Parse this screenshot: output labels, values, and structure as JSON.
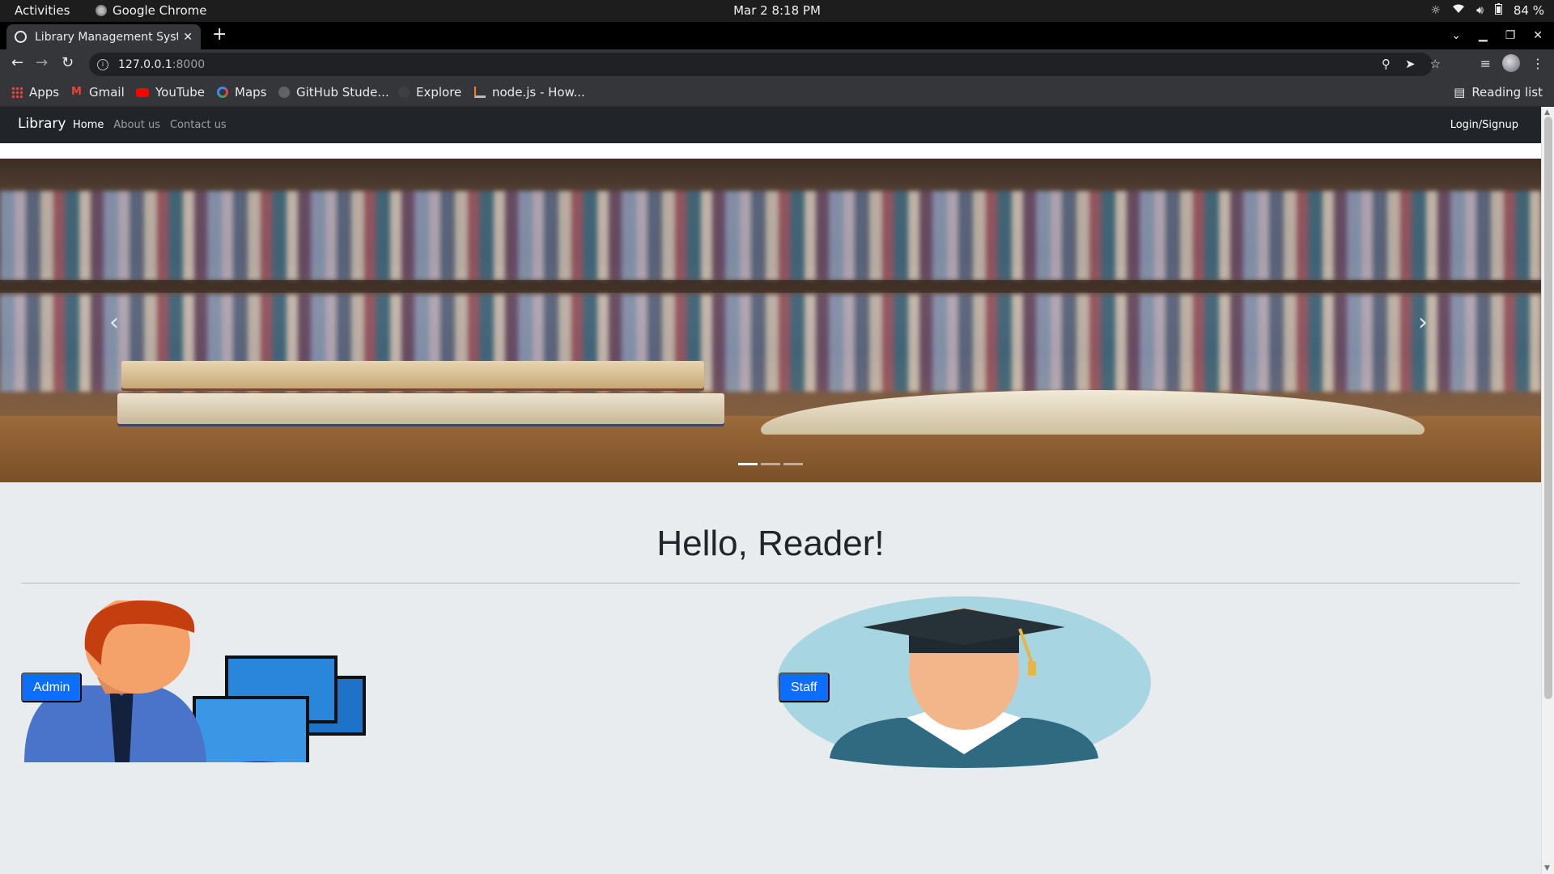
{
  "system": {
    "activities": "Activities",
    "app_name": "Google Chrome",
    "clock": "Mar 2  8:18 PM",
    "battery": "84 %"
  },
  "browser": {
    "tab_title": "Library Management System",
    "url_host": "127.0.0.1",
    "url_port": ":8000",
    "bookmarks": [
      "Apps",
      "Gmail",
      "YouTube",
      "Maps",
      "GitHub Stude...",
      "Explore",
      "node.js - How..."
    ],
    "reading_list": "Reading list"
  },
  "site": {
    "brand": "Library",
    "nav": [
      "Home",
      "About us",
      "Contact us"
    ],
    "login": "Login/Signup",
    "greeting": "Hello, Reader!",
    "admin_button": "Admin",
    "staff_button": "Staff"
  },
  "carousel": {
    "slide_count": 3,
    "active_index": 0
  },
  "colors": {
    "navbar": "#212529",
    "primary": "#0d6efd",
    "page_bg": "#e9ecef"
  }
}
